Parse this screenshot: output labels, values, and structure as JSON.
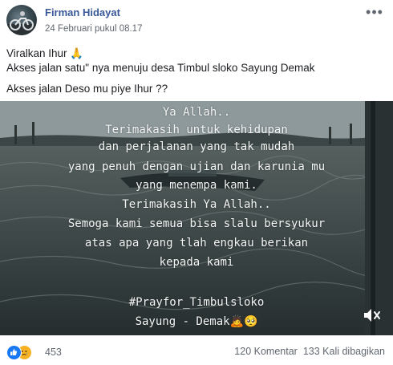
{
  "post": {
    "author": "Firman Hidayat",
    "timestamp": "24 Februari pukul 08.17",
    "text_lines": [
      "Viralkan Ihur 🙏",
      "Akses jalan satu\" nya menuju desa Timbul sloko Sayung Demak",
      "Akses jalan Deso mu piye Ihur ??"
    ]
  },
  "video": {
    "overlay_lines": [
      "Ya Allah..",
      "Terimakasih untuk kehidupan",
      "dan perjalanan yang tak mudah",
      "yang penuh dengan ujian dan karunia mu",
      "yang menempa kami.",
      "Terimakasih Ya Allah..",
      "Semoga kami semua bisa slalu bersyukur",
      "atas apa yang tlah engkau berikan",
      "kepada kami",
      "#Prayfor_Timbulsloko",
      "Sayung - Demak🙇🥺"
    ],
    "mute_icon": "speaker-muted-icon"
  },
  "footer": {
    "reaction_icons": [
      "like-reaction-icon",
      "sad-reaction-icon"
    ],
    "reaction_count": "453",
    "comments": "120 Komentar",
    "shares": "133 Kali dibagikan"
  },
  "colors": {
    "author_link": "#385898",
    "like_blue": "#1877f2",
    "sad_yellow": "#f7b125",
    "muted_text": "#606770"
  }
}
